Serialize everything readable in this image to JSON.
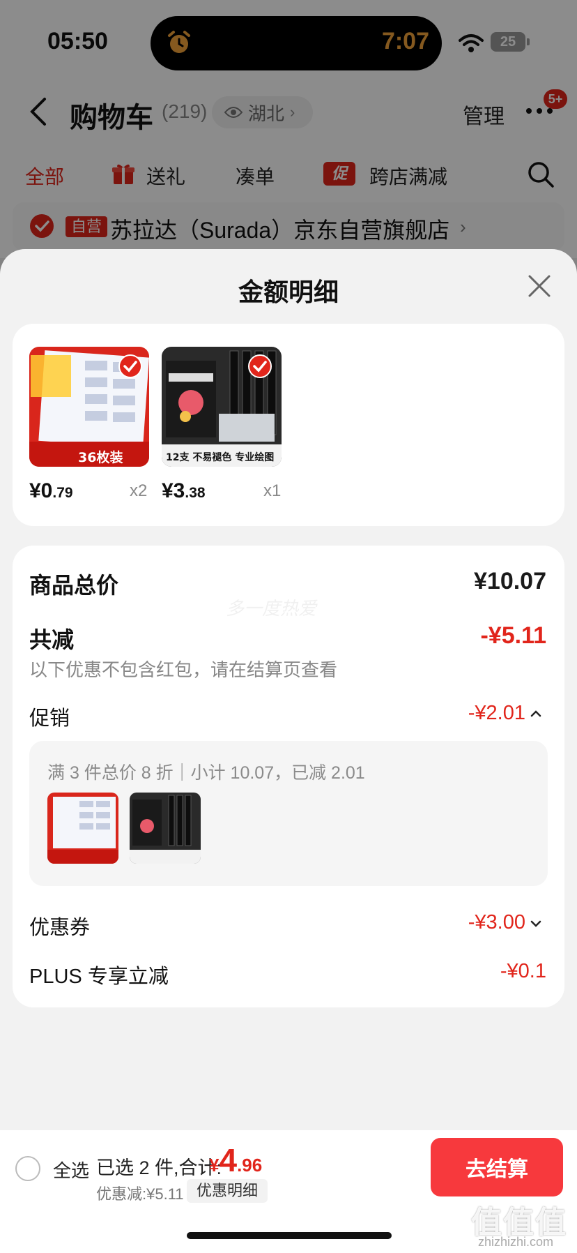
{
  "status_bar": {
    "time": "05:50",
    "island_time": "7:07",
    "battery": "25"
  },
  "header": {
    "title": "购物车",
    "count": "(219)",
    "location": "湖北",
    "manage": "管理",
    "badge": "5+"
  },
  "tabs": [
    "全部",
    "送礼",
    "凑单",
    "跨店满减"
  ],
  "promo_icon_label": "促",
  "store": {
    "badge": "自营",
    "name": "苏拉达（Surada）京东自营旗舰店"
  },
  "sheet": {
    "title": "金额明细",
    "items": [
      {
        "price_int": "¥0",
        "price_dec": ".79",
        "qty": "x2",
        "thumb_caption": "36枚装"
      },
      {
        "price_int": "¥3",
        "price_dec": ".38",
        "qty": "x1",
        "thumb_caption": "12支 不易褪色 专业绘图"
      }
    ],
    "summary": {
      "total_label": "商品总价",
      "total_value": "¥10.07",
      "reduce_label": "共减",
      "reduce_value": "-¥5.11",
      "note": "以下优惠不包含红包，请在结算页查看",
      "promo_label": "促销",
      "promo_value": "-¥2.01",
      "promo_desc": "满 3 件总价 8 折｜小计 10.07，已减 2.01",
      "coupon_label": "优惠券",
      "coupon_value": "-¥3.00",
      "plus_label": "PLUS 专享立减",
      "plus_value": "-¥0.1",
      "watermark": "多一度热爱"
    }
  },
  "bottom": {
    "select_all": "全选",
    "selected": "已选 2 件,合计:",
    "total_currency": "¥",
    "total_int": "4",
    "total_dec": ".96",
    "discount": "优惠减:¥5.11",
    "detail_chip": "优惠明细",
    "checkout": "去结算"
  },
  "brand": {
    "mark": "值值值",
    "url": "zhizhizhi.com"
  },
  "colors": {
    "accent": "#e1251b",
    "checkout": "#f7393d",
    "island_time": "#f2a33a"
  }
}
